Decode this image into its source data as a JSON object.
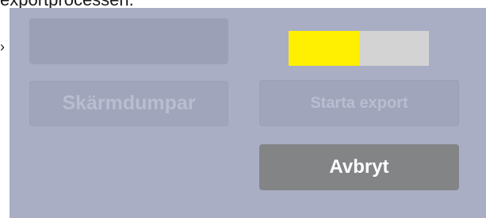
{
  "header": {
    "text": "exportprocessen."
  },
  "dialog": {
    "empty_button_label": "",
    "screenshots_button_label": "Skärmdumpar",
    "start_export_label": "Starta export",
    "cancel_label": "Avbryt",
    "progress": {
      "fraction": 0.5,
      "fill_color": "#ffef00",
      "track_color": "#d3d3d3"
    }
  },
  "colors": {
    "dialog_background": "#a9aec4",
    "cancel_background": "#838486"
  },
  "icons": {
    "chevron": "chevron-right-icon"
  }
}
